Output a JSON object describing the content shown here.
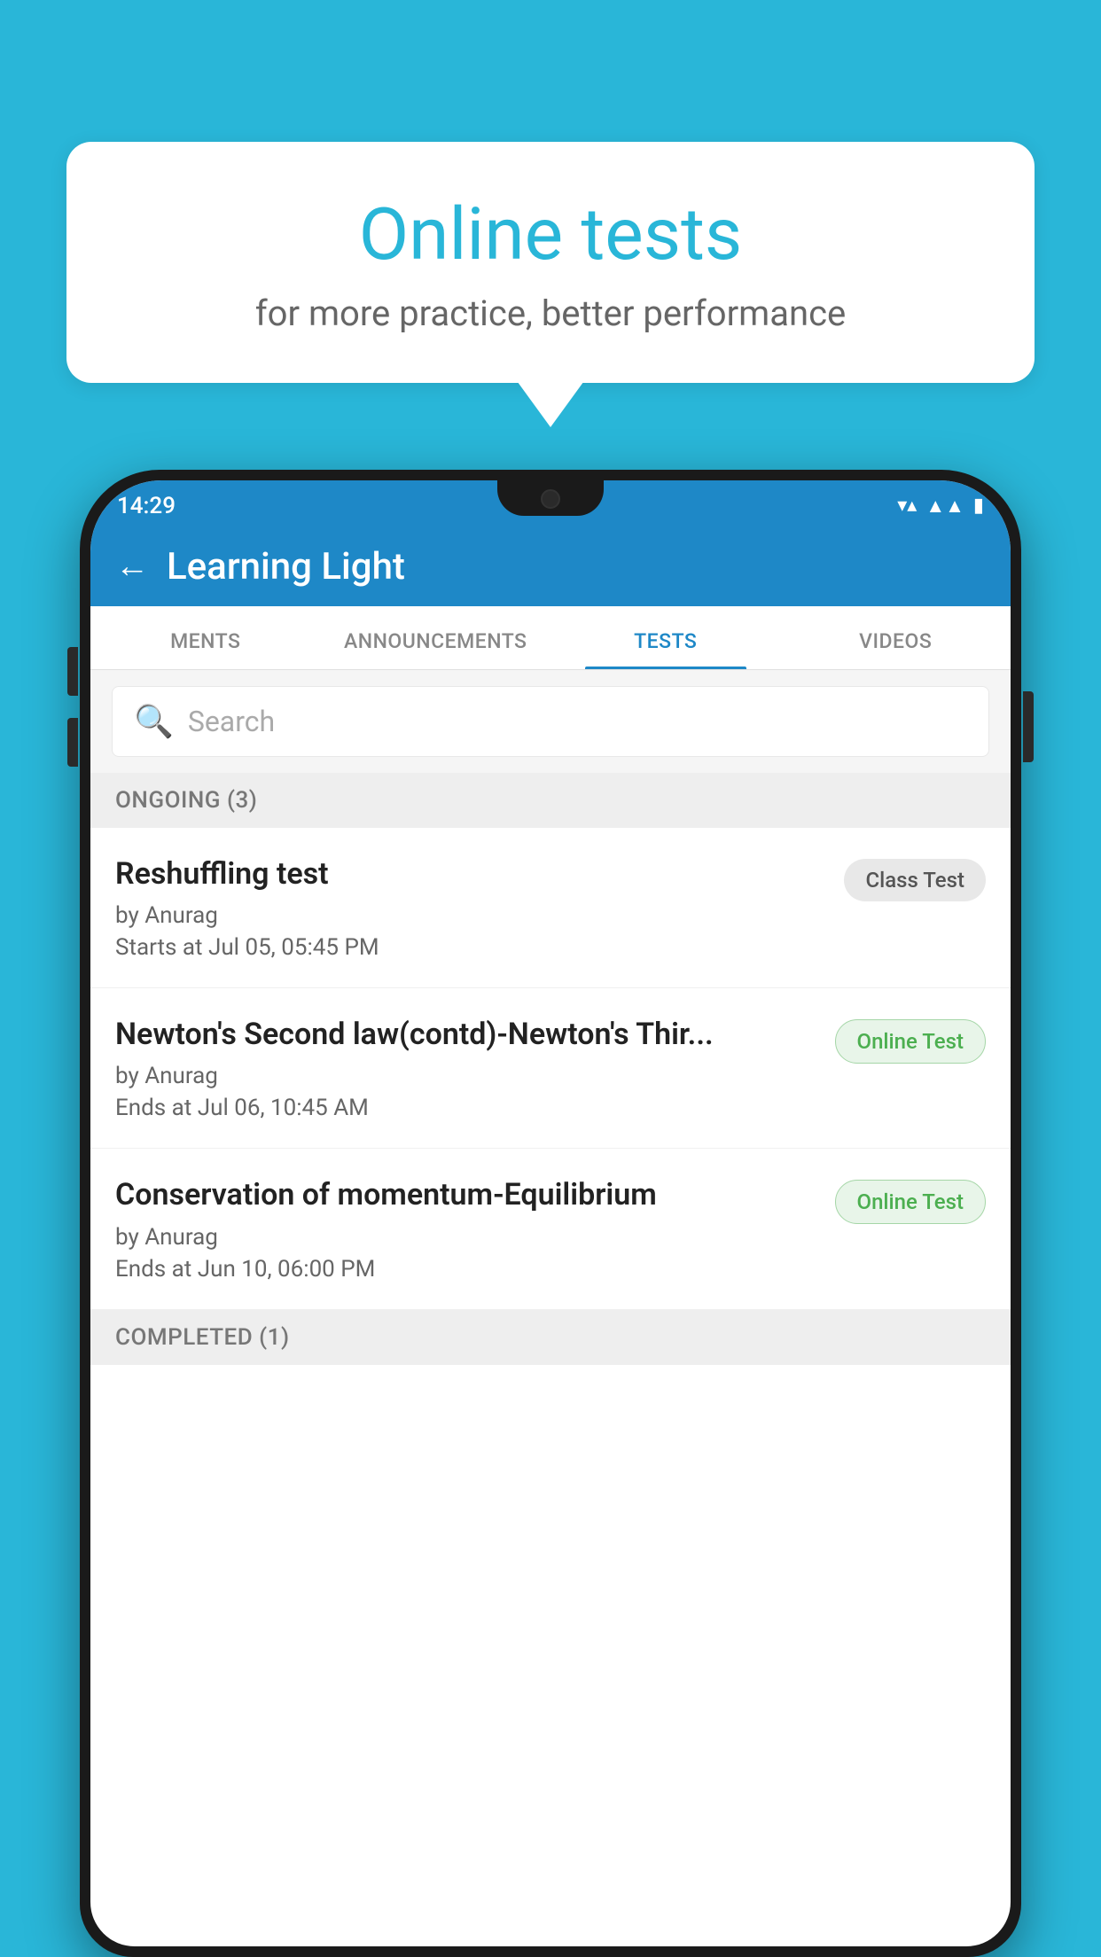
{
  "bubble": {
    "title": "Online tests",
    "subtitle": "for more practice, better performance"
  },
  "status_bar": {
    "time": "14:29",
    "signal_icon": "▼",
    "network_icon": "◀",
    "battery_icon": "▮"
  },
  "app_header": {
    "title": "Learning Light",
    "back_label": "←"
  },
  "tabs": [
    {
      "label": "MENTS",
      "active": false
    },
    {
      "label": "ANNOUNCEMENTS",
      "active": false
    },
    {
      "label": "TESTS",
      "active": true
    },
    {
      "label": "VIDEOS",
      "active": false
    }
  ],
  "search": {
    "placeholder": "Search"
  },
  "ongoing_section": {
    "label": "ONGOING (3)"
  },
  "tests": [
    {
      "name": "Reshuffling test",
      "author": "by Anurag",
      "date": "Starts at  Jul 05, 05:45 PM",
      "badge": "Class Test",
      "badge_type": "class"
    },
    {
      "name": "Newton's Second law(contd)-Newton's Thir...",
      "author": "by Anurag",
      "date": "Ends at  Jul 06, 10:45 AM",
      "badge": "Online Test",
      "badge_type": "online"
    },
    {
      "name": "Conservation of momentum-Equilibrium",
      "author": "by Anurag",
      "date": "Ends at  Jun 10, 06:00 PM",
      "badge": "Online Test",
      "badge_type": "online"
    }
  ],
  "completed_section": {
    "label": "COMPLETED (1)"
  },
  "colors": {
    "primary": "#1e88c7",
    "background": "#29b6d8",
    "online_badge_bg": "#e8f5e9",
    "online_badge_text": "#4caf50",
    "class_badge_bg": "#e8e8e8",
    "class_badge_text": "#555"
  }
}
